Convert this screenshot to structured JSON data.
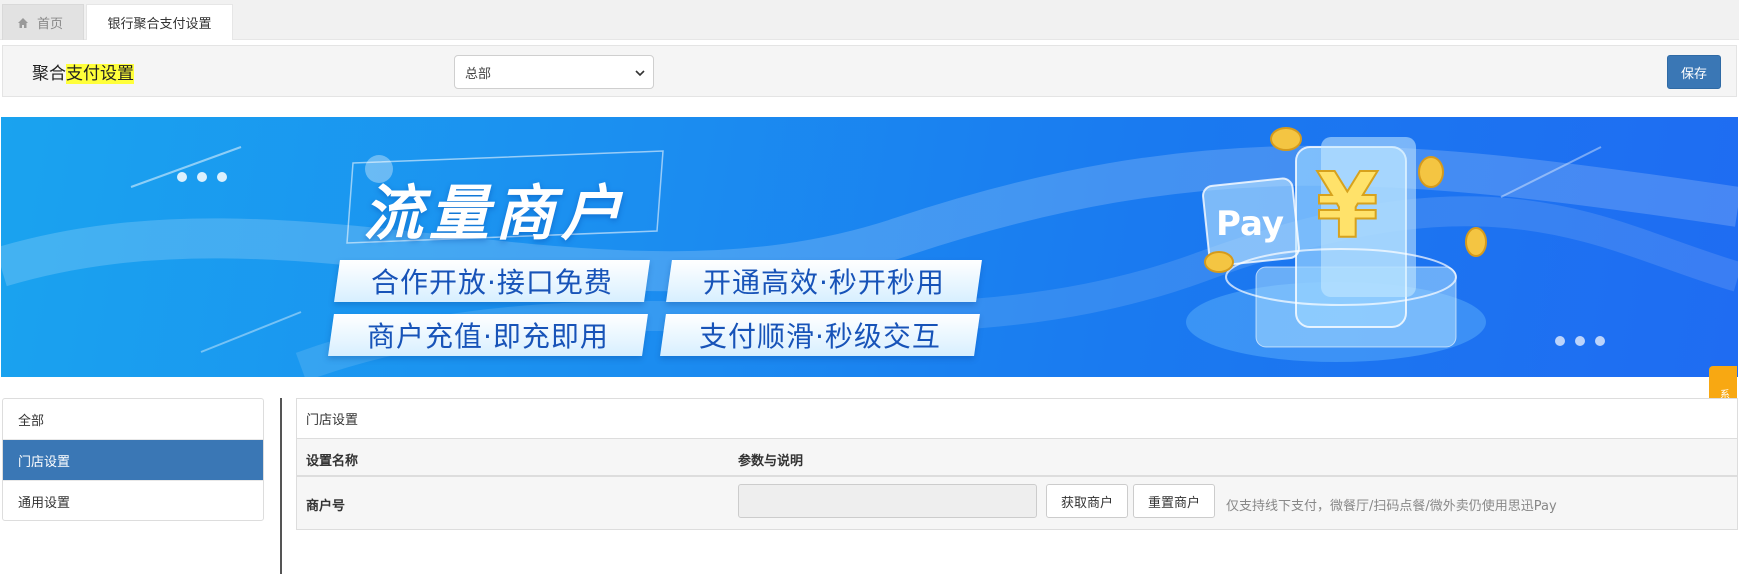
{
  "tabs": {
    "home_label": "首页",
    "active_label": "银行聚合支付设置"
  },
  "header": {
    "title_prefix": "聚合",
    "title_highlight": "支付设置",
    "branch_selected": "总部",
    "save_label": "保存"
  },
  "banner": {
    "title": "流量商户",
    "pills": [
      "合作开放·接口免费",
      "开通高效·秒开秒用",
      "商户充值·即充即用",
      "支付顺滑·秒级交互"
    ],
    "pay_text": "Pay",
    "currency_symbol": "¥"
  },
  "side_notice": "系统提示",
  "menu": {
    "items": [
      {
        "label": "全部"
      },
      {
        "label": "门店设置"
      },
      {
        "label": "通用设置"
      }
    ],
    "active_index": 1
  },
  "panel": {
    "title": "门店设置",
    "col_name": "设置名称",
    "col_param": "参数与说明",
    "row": {
      "label": "商户号",
      "input_value": "",
      "btn_fetch": "获取商户",
      "btn_reset": "重置商户",
      "hint": "仅支持线下支付，微餐厅/扫码点餐/微外卖仍使用思迅Pay"
    }
  },
  "colors": {
    "primary": "#3a77b5",
    "highlight": "#ffff3a",
    "notice": "#f8a812",
    "banner": "#1a8af0"
  }
}
